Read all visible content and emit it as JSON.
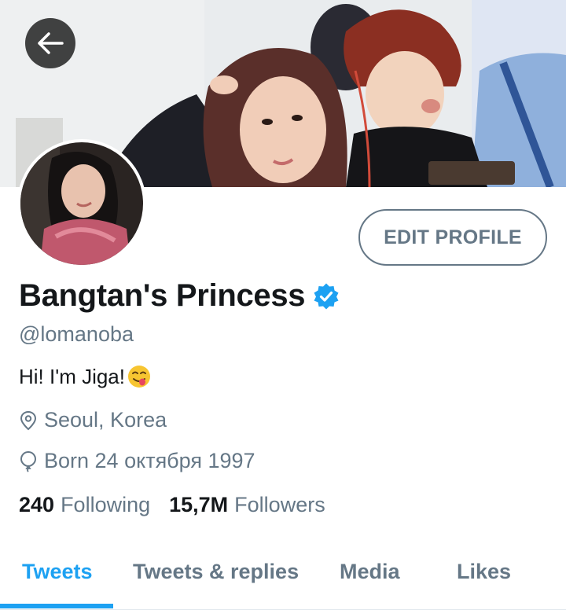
{
  "profile": {
    "display_name": "Bangtan's Princess",
    "handle": "@lomanoba",
    "bio": "Hi! I'm Jiga!",
    "bio_emoji": "yum-face-emoji",
    "location": "Seoul, Korea",
    "birth": "Born 24 октября 1997",
    "verified": true
  },
  "actions": {
    "edit_profile_label": "EDIT PROFILE"
  },
  "stats": {
    "following_count": "240",
    "following_label": "Following",
    "followers_count": "15,7M",
    "followers_label": "Followers"
  },
  "tabs": [
    {
      "label": "Tweets",
      "active": true
    },
    {
      "label": "Tweets & replies",
      "active": false
    },
    {
      "label": "Media",
      "active": false
    },
    {
      "label": "Likes",
      "active": false
    }
  ],
  "colors": {
    "accent": "#1da1f2",
    "secondary_text": "#657786",
    "primary_text": "#14171a"
  },
  "icons": {
    "back": "arrow-left-icon",
    "verified": "verified-badge-icon",
    "location": "location-pin-icon",
    "birth": "balloon-icon"
  }
}
